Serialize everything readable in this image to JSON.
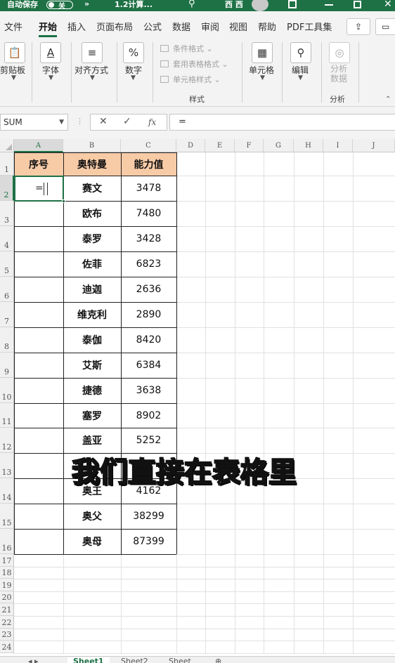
{
  "titlebar": {
    "autosave_label": "自动保存",
    "autosave_state": "关",
    "more": "»",
    "doc_title": "1.2计算...",
    "user": "西 西"
  },
  "tabs": {
    "items": [
      "文件",
      "开始",
      "插入",
      "页面布局",
      "公式",
      "数据",
      "审阅",
      "视图",
      "帮助",
      "PDF工具集"
    ],
    "active": "开始"
  },
  "ribbon": {
    "clipboard": "剪贴板",
    "font": "字体",
    "align": "对齐方式",
    "number": "数字",
    "conditional_format": "条件格式",
    "table_format": "套用表格格式",
    "cell_style": "单元格样式",
    "styles_group": "样式",
    "cells": "单元格",
    "editing": "编辑",
    "analyze": "分析\n数据",
    "analyze_group": "分析"
  },
  "formula_bar": {
    "name_box": "SUM",
    "cancel_icon": "✕",
    "enter_icon": "✓",
    "fx_label": "fx",
    "value": "="
  },
  "grid": {
    "columns": [
      "A",
      "B",
      "C",
      "D",
      "E",
      "F",
      "G",
      "H",
      "I",
      "J"
    ],
    "selected_column": "A",
    "selected_row": "2",
    "rows": [
      "1",
      "2",
      "3",
      "4",
      "5",
      "6",
      "7",
      "8",
      "9",
      "10",
      "11",
      "12",
      "13",
      "14",
      "15",
      "16",
      "17",
      "18",
      "19",
      "20",
      "21",
      "22",
      "23",
      "24"
    ],
    "headers": [
      "序号",
      "奥特曼",
      "能力值"
    ],
    "names": [
      "赛文",
      "欧布",
      "泰罗",
      "佐菲",
      "迪迦",
      "维克利",
      "泰伽",
      "艾斯",
      "捷德",
      "塞罗",
      "盖亚",
      "",
      "奥王",
      "奥父",
      "奥母"
    ],
    "values": [
      "3478",
      "7480",
      "3428",
      "6823",
      "2636",
      "2890",
      "8420",
      "6384",
      "3638",
      "8902",
      "5252",
      "",
      "4162",
      "38299",
      "87399"
    ],
    "active_cell_input": "="
  },
  "caption": "我们直接在表格里",
  "sheets": [
    "Sheet1",
    "Sheet2",
    "Sheet"
  ]
}
